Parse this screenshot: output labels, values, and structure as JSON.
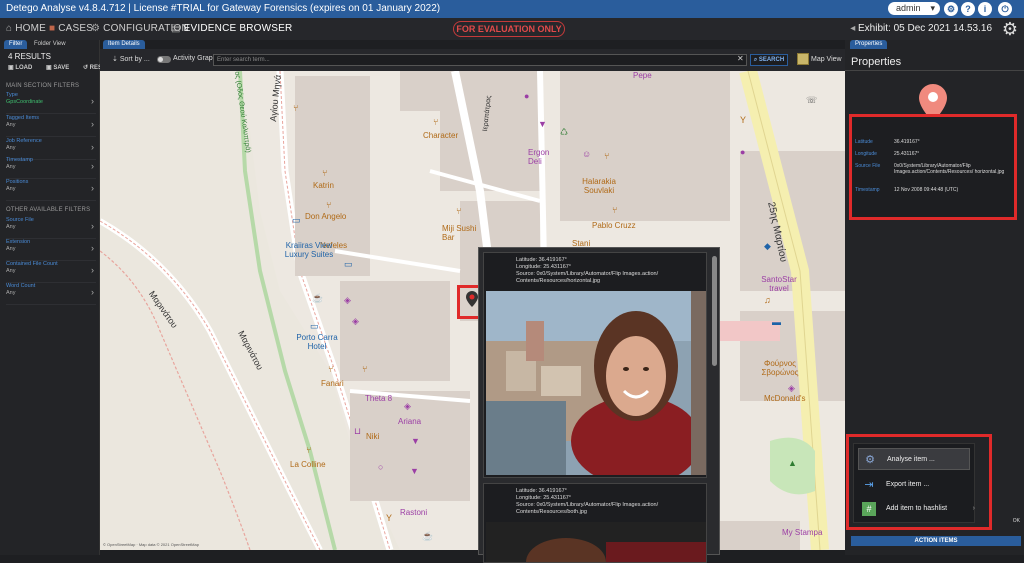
{
  "window": {
    "title": "Detego Analyse v4.8.4.712 | License #TRIAL for Gateway Forensics (expires on 01 January 2022)",
    "user": "admin"
  },
  "nav": {
    "items": [
      {
        "label": "HOME",
        "icon": "home-icon"
      },
      {
        "label": "CASES",
        "icon": "cases-icon"
      },
      {
        "label": "CONFIGURATION",
        "icon": "gear-icon"
      },
      {
        "label": "EVIDENCE BROWSER",
        "icon": "document-icon"
      }
    ],
    "eval_badge": "FOR EVALUATION ONLY",
    "exhibit": "Exhibit: 05 Dec 2021 14.53.16"
  },
  "left_panel": {
    "tabs": [
      "Filter",
      "Folder View"
    ],
    "results": "4 RESULTS",
    "actions": [
      "LOAD",
      "SAVE",
      "RESET"
    ],
    "main_section_title": "MAIN SECTION FILTERS",
    "main_filters": [
      {
        "label": "Type",
        "value": "GpsCoordinate",
        "active": true
      },
      {
        "label": "Tagged Items",
        "value": "Any",
        "active": false
      },
      {
        "label": "Job Reference",
        "value": "Any",
        "active": false
      },
      {
        "label": "Timestamp",
        "value": "Any",
        "active": false
      },
      {
        "label": "Positions",
        "value": "Any",
        "active": false
      }
    ],
    "other_section_title": "OTHER AVAILABLE FILTERS",
    "other_filters": [
      {
        "label": "Source File",
        "value": "Any"
      },
      {
        "label": "Extension",
        "value": "Any"
      },
      {
        "label": "Contained File Count",
        "value": "Any"
      },
      {
        "label": "Word Count",
        "value": "Any"
      }
    ]
  },
  "center": {
    "tab": "Item Details",
    "sort_by": "Sort by ...",
    "activity_graph": "Activity Graph",
    "search_placeholder": "Enter search term...",
    "search_button": "SEARCH",
    "map_view": "Map View",
    "map_copyright": "© OpenStreetMap · Map data © 2021 OpenStreetMap"
  },
  "map": {
    "streets": [
      "Αγίου Μηνά",
      "Μαρινάτου",
      "Μαρινάτου",
      "Ιεραπάτρας",
      "25ης Μαρτίου",
      "ος (Οδός Θεού Καλυπτρά)"
    ],
    "pois": [
      {
        "label": "Character",
        "kind": "poi"
      },
      {
        "label": "Katrin",
        "kind": "poi"
      },
      {
        "label": "Don Angelo",
        "kind": "poi"
      },
      {
        "label": "Nefeles",
        "kind": "poi"
      },
      {
        "label": "Miji Sushi Bar",
        "kind": "poi"
      },
      {
        "label": "Ergon Deli",
        "kind": "shop"
      },
      {
        "label": "Halarakia Souvlaki",
        "kind": "poi"
      },
      {
        "label": "Pablo Cruzz",
        "kind": "poi"
      },
      {
        "label": "Stani",
        "kind": "poi"
      },
      {
        "label": "Kraiiras View Luxury Suites",
        "kind": "hotel"
      },
      {
        "label": "Porto Carra Hotel",
        "kind": "hotel"
      },
      {
        "label": "Fanari",
        "kind": "poi"
      },
      {
        "label": "Theta 8",
        "kind": "shop"
      },
      {
        "label": "Ariana",
        "kind": "shop"
      },
      {
        "label": "Niki",
        "kind": "poi"
      },
      {
        "label": "La Colline",
        "kind": "poi"
      },
      {
        "label": "Rastoni",
        "kind": "shop"
      },
      {
        "label": "SantoStar travel",
        "kind": "shop"
      },
      {
        "label": "Φούρνος Σβορώνος",
        "kind": "poi"
      },
      {
        "label": "McDonald's",
        "kind": "poi"
      },
      {
        "label": "My Stampa",
        "kind": "shop"
      },
      {
        "label": "Pepe",
        "kind": "shop"
      }
    ]
  },
  "popup": {
    "items": [
      {
        "latitude": "Latitude: 36.419167°",
        "longitude": "Longitude: 25.431167°",
        "source": "Source: 0x0/System/Library/Automator/Flip Images.action/",
        "source2": "Contents/Resources/horizontal.jpg"
      },
      {
        "latitude": "Latitude: 36.419167°",
        "longitude": "Longitude: 25.431167°",
        "source": "Source: 0x0/System/Library/Automator/Flip Images.action/",
        "source2": "Contents/Resources/both.jpg"
      }
    ]
  },
  "right_panel": {
    "tab": "Properties",
    "title": "Properties",
    "properties": [
      {
        "key": "Latitude",
        "value": "36.419167°"
      },
      {
        "key": "Longitude",
        "value": "25.431167°"
      },
      {
        "key": "Source File",
        "value": "0x0/System/Library/Automator/Flip Images.action/Contents/Resources/ horizontal.jpg"
      },
      {
        "key": "Timestamp",
        "value": "12 Nov 2008 09:44:48 (UTC)"
      }
    ],
    "context_menu": [
      {
        "label": "Analyse item ...",
        "icon": "gears-icon"
      },
      {
        "label": "Export item ...",
        "icon": "export-icon"
      },
      {
        "label": "Add item to hashlist",
        "icon": "hash-icon"
      }
    ],
    "ok_label": "OK",
    "action_button": "ACTION ITEMS"
  },
  "colors": {
    "accent": "#2a5d9c",
    "highlight": "#e02a2a",
    "map_bg": "#ede8e1"
  }
}
